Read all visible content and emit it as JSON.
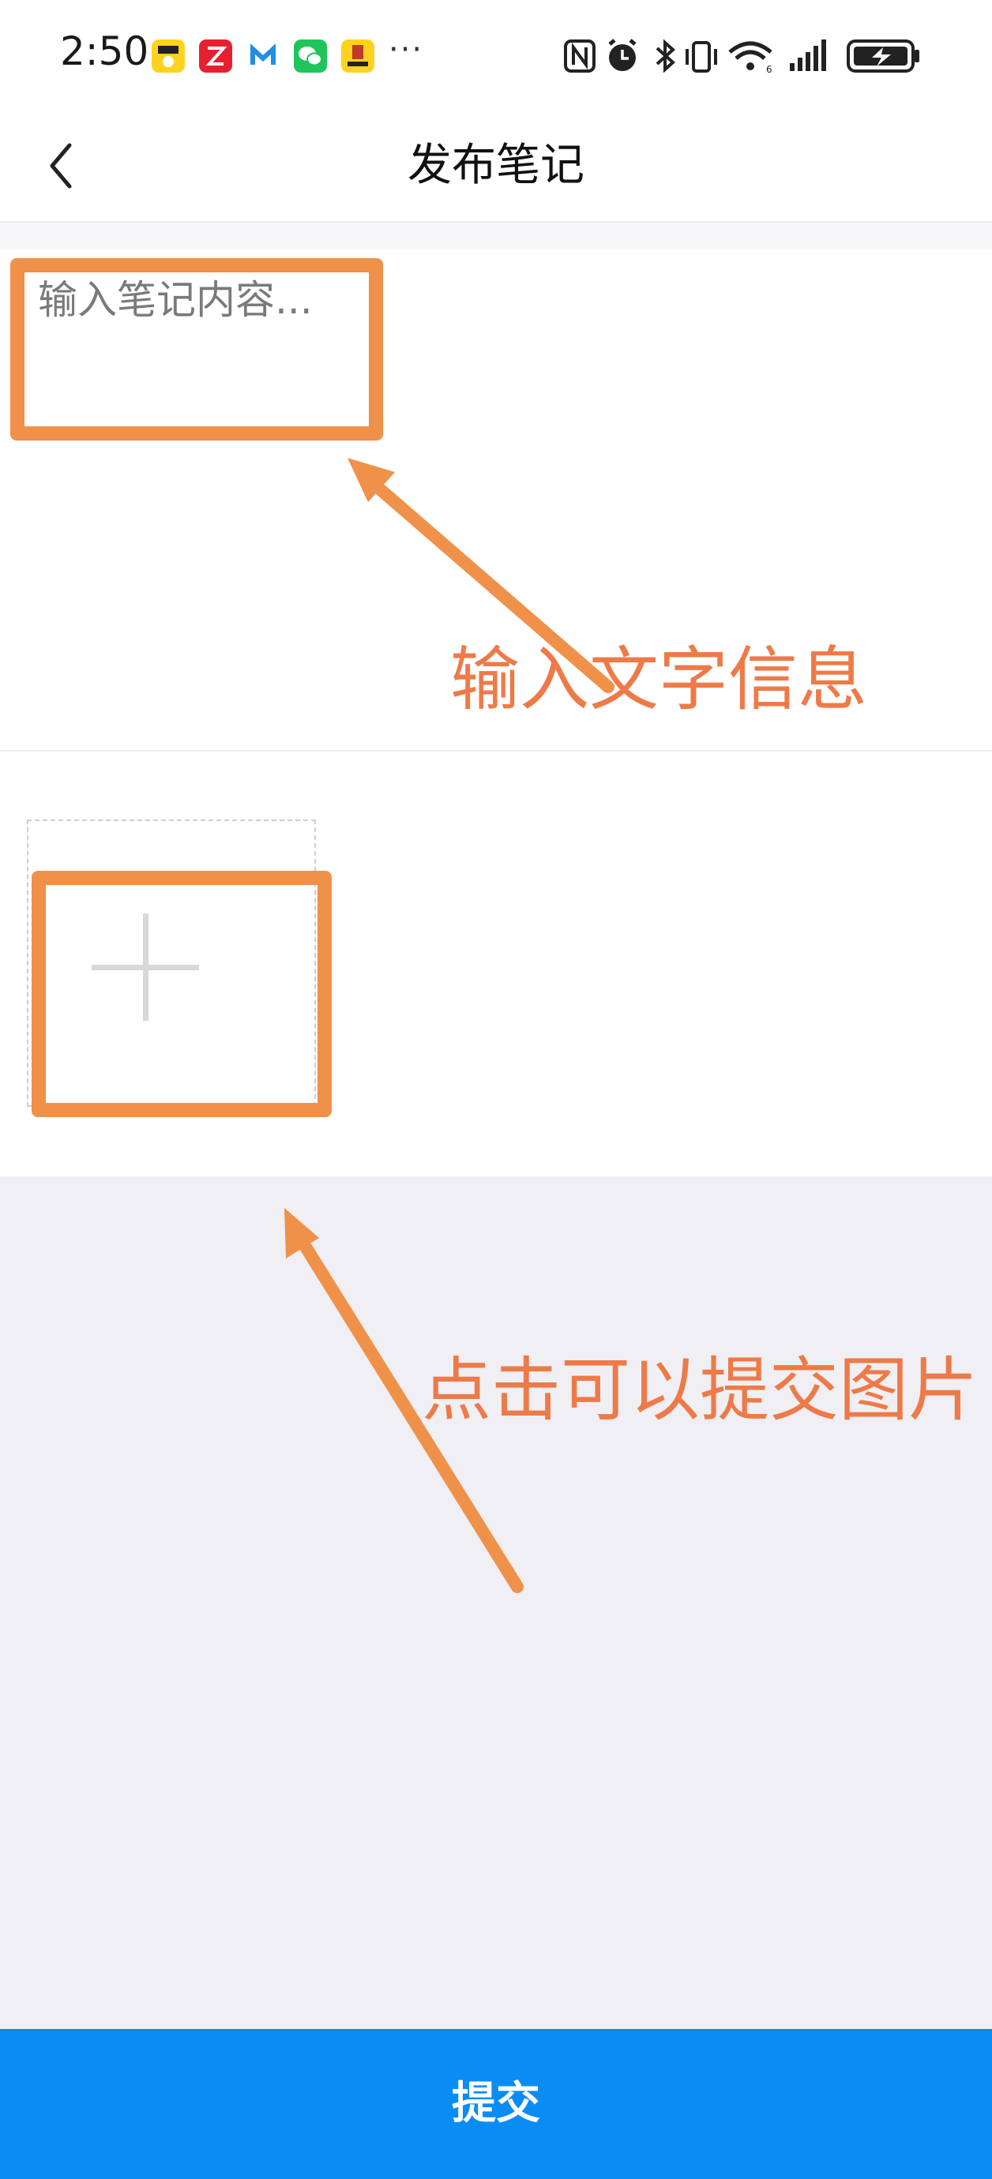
{
  "status_bar": {
    "time": "2:50",
    "more": "···",
    "notification_icons": [
      {
        "name": "app-yellow-icon",
        "color": "#ffd21f"
      },
      {
        "name": "app-red-icon",
        "color": "#e6212f"
      },
      {
        "name": "app-blue-m-icon",
        "color": "#2aa0ea"
      },
      {
        "name": "wechat-icon",
        "color": "#21c45a"
      },
      {
        "name": "app-yellow-2-icon",
        "color": "#ffd21f"
      }
    ],
    "system_icons": [
      "nfc-icon",
      "alarm-icon",
      "bluetooth-icon",
      "vibrate-icon",
      "wifi-icon",
      "signal-icon",
      "battery-charging-icon"
    ]
  },
  "nav": {
    "title": "发布笔记",
    "back_icon": "chevron-left-icon"
  },
  "note": {
    "placeholder": "输入笔记内容...",
    "value": ""
  },
  "upload": {
    "icon": "plus-icon"
  },
  "submit": {
    "label": "提交",
    "color": "#0a8cf5"
  },
  "annotations": {
    "color": "#f0914a",
    "text_input_hint": "输入文字信息",
    "image_hint": "点击可以提交图片"
  }
}
